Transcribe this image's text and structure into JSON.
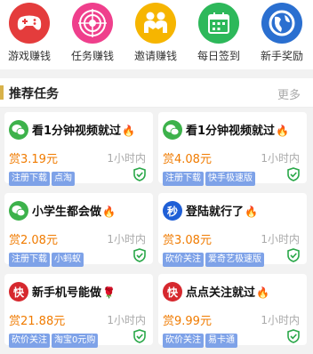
{
  "top_icons": [
    {
      "label": "游戏赚钱",
      "icon": "gamepad-icon",
      "color": "#e43c3c"
    },
    {
      "label": "任务赚钱",
      "icon": "target-icon",
      "color": "#ef3f8c"
    },
    {
      "label": "邀请赚钱",
      "icon": "people-icon",
      "color": "#f6b500"
    },
    {
      "label": "每日签到",
      "icon": "calendar-icon",
      "color": "#2db85a"
    },
    {
      "label": "新手奖励",
      "icon": "globe-icon",
      "color": "#2a6fd0"
    }
  ],
  "section": {
    "title": "推荐任务",
    "more": "更多"
  },
  "tasks": [
    {
      "title": "看1分钟视频就过",
      "emoji": "🔥",
      "logo": "wechat-icon",
      "price": "赏3.19元",
      "time": "1小时内",
      "tags": [
        "注册下载",
        "点淘"
      ]
    },
    {
      "title": "看1分钟视频就过",
      "emoji": "🔥",
      "logo": "wechat-icon",
      "price": "赏4.08元",
      "time": "1小时内",
      "tags": [
        "注册下载",
        "快手极速版"
      ]
    },
    {
      "title": "小学生都会做",
      "emoji": "🔥",
      "logo": "wechat-icon",
      "price": "赏2.08元",
      "time": "1小时内",
      "tags": [
        "注册下载",
        "小蚂蚁"
      ]
    },
    {
      "title": "登陆就行了",
      "emoji": "🔥",
      "logo": "seconds-badge-icon",
      "logo_text": "秒",
      "price": "赏3.08元",
      "time": "1小时内",
      "tags": [
        "砍价关注",
        "爱奇艺极速版"
      ]
    },
    {
      "title": "新手机号能做",
      "emoji": "🌹",
      "logo": "kuai-badge-icon",
      "logo_text": "快",
      "price": "赏21.88元",
      "time": "1小时内",
      "tags": [
        "砍价关注",
        "淘宝0元购"
      ]
    },
    {
      "title": "点点关注就过",
      "emoji": "🔥",
      "logo": "kuai-badge-icon",
      "logo_text": "快",
      "price": "赏9.99元",
      "time": "1小时内",
      "tags": [
        "砍价关注",
        "易卡通"
      ]
    }
  ]
}
